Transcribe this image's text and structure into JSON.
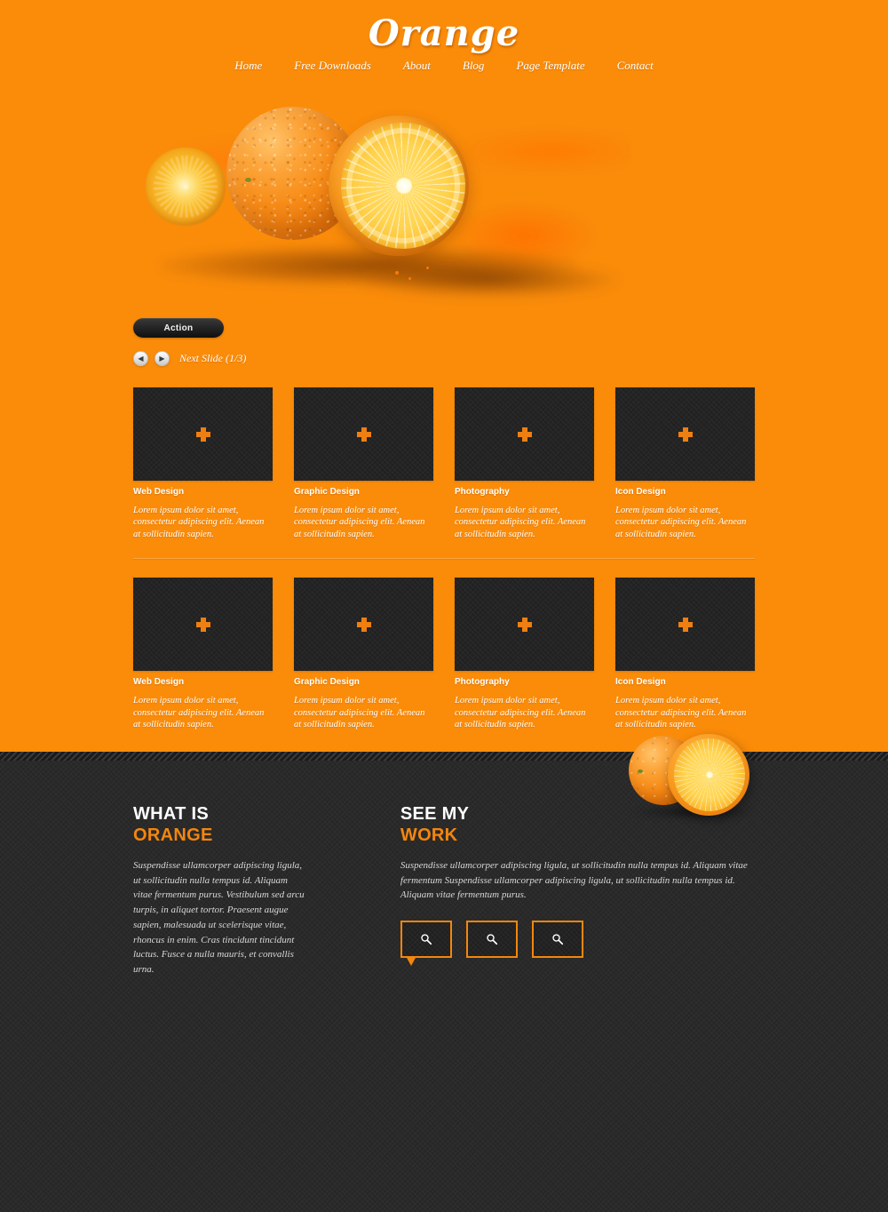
{
  "theme": {
    "orange": "#fa8c0a",
    "accent": "#f3860f",
    "dark": "#2a2a2a",
    "thumb_dark": "#242424",
    "text_white": "#ffffff"
  },
  "header": {
    "site_title": "Orange",
    "nav": [
      {
        "label": "Home",
        "name": "nav-home"
      },
      {
        "label": "Free Downloads",
        "name": "nav-free-downloads"
      },
      {
        "label": "About",
        "name": "nav-about"
      },
      {
        "label": "Blog",
        "name": "nav-blog"
      },
      {
        "label": "Page Template",
        "name": "nav-page-template"
      },
      {
        "label": "Contact",
        "name": "nav-contact"
      }
    ]
  },
  "hero": {
    "action_label": "Action",
    "prev_icon": "chevron-left-icon",
    "next_icon": "chevron-right-icon",
    "prev_glyph": "◀",
    "next_glyph": "▶",
    "slide_label": "Next Slide (1/3)",
    "slide_current": 1,
    "slide_total": 3,
    "image_alt": "oranges-splash-photo"
  },
  "portfolio": {
    "plus_icon": "plus-icon",
    "rows": [
      {
        "items": [
          {
            "title": "Web Design",
            "desc": "Lorem ipsum dolor sit amet, consectetur adipiscing elit. Aenean at sollicitudin sapien."
          },
          {
            "title": "Graphic Design",
            "desc": "Lorem ipsum dolor sit amet, consectetur adipiscing elit. Aenean at sollicitudin sapien."
          },
          {
            "title": "Photography",
            "desc": "Lorem ipsum dolor sit amet, consectetur adipiscing elit. Aenean at sollicitudin sapien."
          },
          {
            "title": "Icon Design",
            "desc": "Lorem ipsum dolor sit amet, consectetur adipiscing elit. Aenean at sollicitudin sapien."
          }
        ]
      },
      {
        "items": [
          {
            "title": "Web Design",
            "desc": "Lorem ipsum dolor sit amet, consectetur adipiscing elit. Aenean at sollicitudin sapien."
          },
          {
            "title": "Graphic Design",
            "desc": "Lorem ipsum dolor sit amet, consectetur adipiscing elit. Aenean at sollicitudin sapien."
          },
          {
            "title": "Photography",
            "desc": "Lorem ipsum dolor sit amet, consectetur adipiscing elit. Aenean at sollicitudin sapien."
          },
          {
            "title": "Icon Design",
            "desc": "Lorem ipsum dolor sit amet, consectetur adipiscing elit. Aenean at sollicitudin sapien."
          }
        ]
      }
    ]
  },
  "about": {
    "heading_line1": "WHAT IS",
    "heading_line2": "ORANGE",
    "body": "Suspendisse ullamcorper adipiscing ligula, ut sollicitudin nulla tempus id. Aliquam vitae fermentum purus. Vestibulum sed arcu turpis, in aliquet tortor. Praesent augue sapien, malesuada ut scelerisque vitae, rhoncus in enim. Cras tincidunt tincidunt luctus. Fusce a nulla mauris, et convallis urna."
  },
  "work": {
    "heading_line1": "SEE MY",
    "heading_line2": "WORK",
    "body": "Suspendisse ullamcorper adipiscing ligula, ut sollicitudin nulla tempus id. Aliquam vitae fermentum Suspendisse ullamcorper adipiscing ligula, ut sollicitudin nulla tempus id. Aliquam vitae fermentum purus.",
    "thumb_icon": "magnifier-icon",
    "thumbs": [
      {
        "name": "work-thumb-1",
        "has_tail": true
      },
      {
        "name": "work-thumb-2",
        "has_tail": false
      },
      {
        "name": "work-thumb-3",
        "has_tail": false
      }
    ]
  },
  "decor": {
    "corner_oranges_alt": "oranges-photo"
  }
}
